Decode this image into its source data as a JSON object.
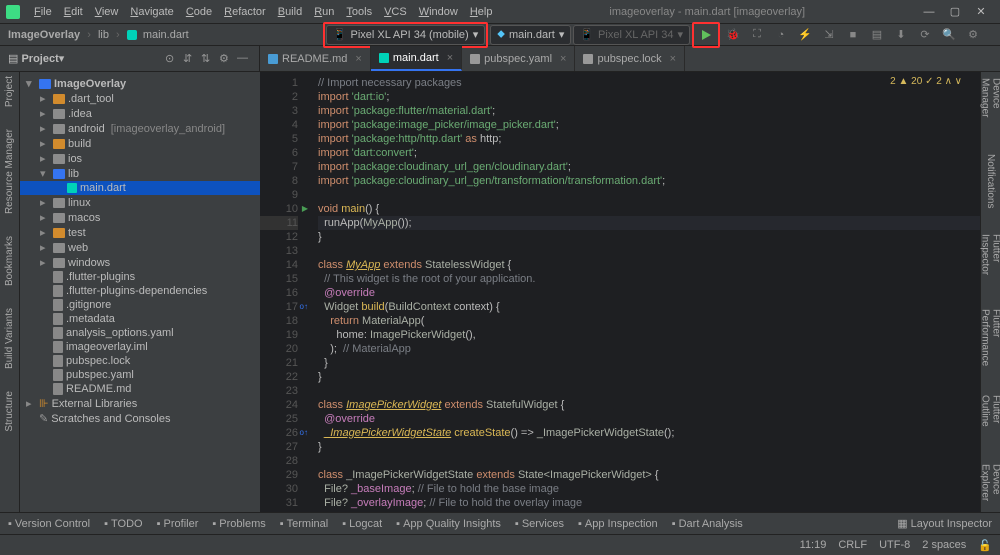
{
  "window": {
    "title": "imageoverlay - main.dart [imageoverlay]",
    "menus": [
      "File",
      "Edit",
      "View",
      "Navigate",
      "Code",
      "Refactor",
      "Build",
      "Run",
      "Tools",
      "VCS",
      "Window",
      "Help"
    ]
  },
  "breadcrumb": {
    "project": "ImageOverlay",
    "folder": "lib",
    "file": "main.dart"
  },
  "project_panel": {
    "title": "Project"
  },
  "device_selector": {
    "label": "Pixel XL API 34 (mobile)"
  },
  "run_config": {
    "label": "main.dart"
  },
  "run_target": {
    "label": "Pixel XL API 34"
  },
  "editor_tabs": [
    {
      "label": "README.md",
      "icon": "md"
    },
    {
      "label": "main.dart",
      "icon": "dart",
      "active": true
    },
    {
      "label": "pubspec.yaml",
      "icon": "yaml"
    },
    {
      "label": "pubspec.lock",
      "icon": "lock"
    }
  ],
  "warnings": {
    "text": "2 ▲ 20 ✓ 2 ∧ ∨"
  },
  "tree": [
    {
      "ind": 0,
      "arrow": "▾",
      "icon": "folder-blue",
      "label": "ImageOverlay",
      "bold": true
    },
    {
      "ind": 1,
      "arrow": "▸",
      "icon": "folder-orange",
      "label": ".dart_tool"
    },
    {
      "ind": 1,
      "arrow": "▸",
      "icon": "folder",
      "label": ".idea"
    },
    {
      "ind": 1,
      "arrow": "▸",
      "icon": "folder",
      "label": "android",
      "suffix": "[imageoverlay_android]"
    },
    {
      "ind": 1,
      "arrow": "▸",
      "icon": "folder-orange",
      "label": "build"
    },
    {
      "ind": 1,
      "arrow": "▸",
      "icon": "folder",
      "label": "ios"
    },
    {
      "ind": 1,
      "arrow": "▾",
      "icon": "folder-blue",
      "label": "lib"
    },
    {
      "ind": 2,
      "arrow": "",
      "icon": "dart",
      "label": "main.dart",
      "selected": true
    },
    {
      "ind": 1,
      "arrow": "▸",
      "icon": "folder",
      "label": "linux"
    },
    {
      "ind": 1,
      "arrow": "▸",
      "icon": "folder",
      "label": "macos"
    },
    {
      "ind": 1,
      "arrow": "▸",
      "icon": "folder-orange",
      "label": "test"
    },
    {
      "ind": 1,
      "arrow": "▸",
      "icon": "folder",
      "label": "web"
    },
    {
      "ind": 1,
      "arrow": "▸",
      "icon": "folder",
      "label": "windows"
    },
    {
      "ind": 1,
      "arrow": "",
      "icon": "file",
      "label": ".flutter-plugins"
    },
    {
      "ind": 1,
      "arrow": "",
      "icon": "file",
      "label": ".flutter-plugins-dependencies"
    },
    {
      "ind": 1,
      "arrow": "",
      "icon": "file",
      "label": ".gitignore"
    },
    {
      "ind": 1,
      "arrow": "",
      "icon": "file",
      "label": ".metadata"
    },
    {
      "ind": 1,
      "arrow": "",
      "icon": "file",
      "label": "analysis_options.yaml"
    },
    {
      "ind": 1,
      "arrow": "",
      "icon": "file",
      "label": "imageoverlay.iml"
    },
    {
      "ind": 1,
      "arrow": "",
      "icon": "file",
      "label": "pubspec.lock"
    },
    {
      "ind": 1,
      "arrow": "",
      "icon": "file",
      "label": "pubspec.yaml"
    },
    {
      "ind": 1,
      "arrow": "",
      "icon": "file",
      "label": "README.md"
    },
    {
      "ind": 0,
      "arrow": "▸",
      "icon": "lib",
      "label": "External Libraries"
    },
    {
      "ind": 0,
      "arrow": "",
      "icon": "scratch",
      "label": "Scratches and Consoles"
    }
  ],
  "code_lines": [
    {
      "n": 1,
      "tokens": [
        {
          "c": "cmt",
          "t": "// Import necessary packages"
        }
      ]
    },
    {
      "n": 2,
      "tokens": [
        {
          "c": "kw",
          "t": "import "
        },
        {
          "c": "str",
          "t": "'dart:io'"
        },
        {
          "c": "",
          "t": ";"
        }
      ]
    },
    {
      "n": 3,
      "tokens": [
        {
          "c": "kw",
          "t": "import "
        },
        {
          "c": "str",
          "t": "'package:flutter/material.dart'"
        },
        {
          "c": "",
          "t": ";"
        }
      ]
    },
    {
      "n": 4,
      "tokens": [
        {
          "c": "kw",
          "t": "import "
        },
        {
          "c": "str",
          "t": "'package:image_picker/image_picker.dart'"
        },
        {
          "c": "",
          "t": ";"
        }
      ]
    },
    {
      "n": 5,
      "tokens": [
        {
          "c": "kw",
          "t": "import "
        },
        {
          "c": "str",
          "t": "'package:http/http.dart'"
        },
        {
          "c": "kw",
          "t": " as "
        },
        {
          "c": "",
          "t": "http;"
        }
      ]
    },
    {
      "n": 6,
      "tokens": [
        {
          "c": "kw",
          "t": "import "
        },
        {
          "c": "str",
          "t": "'dart:convert'"
        },
        {
          "c": "",
          "t": ";"
        }
      ]
    },
    {
      "n": 7,
      "tokens": [
        {
          "c": "kw",
          "t": "import "
        },
        {
          "c": "str",
          "t": "'package:cloudinary_url_gen/cloudinary.dart'"
        },
        {
          "c": "",
          "t": ";"
        }
      ]
    },
    {
      "n": 8,
      "tokens": [
        {
          "c": "kw",
          "t": "import "
        },
        {
          "c": "str",
          "t": "'package:cloudinary_url_gen/transformation/transformation.dart'"
        },
        {
          "c": "",
          "t": ";"
        }
      ]
    },
    {
      "n": 9,
      "tokens": []
    },
    {
      "n": 10,
      "run": true,
      "tokens": [
        {
          "c": "kw",
          "t": "void "
        },
        {
          "c": "fn",
          "t": "main"
        },
        {
          "c": "",
          "t": "() {"
        }
      ]
    },
    {
      "n": 11,
      "hl": true,
      "tokens": [
        {
          "c": "",
          "t": "  runApp("
        },
        {
          "c": "type",
          "t": "MyApp"
        },
        {
          "c": "",
          "t": "());"
        }
      ]
    },
    {
      "n": 12,
      "tokens": [
        {
          "c": "",
          "t": "}"
        }
      ]
    },
    {
      "n": 13,
      "tokens": []
    },
    {
      "n": 14,
      "tokens": [
        {
          "c": "kw",
          "t": "class "
        },
        {
          "c": "cls",
          "t": "MyApp"
        },
        {
          "c": "kw",
          "t": " extends "
        },
        {
          "c": "type",
          "t": "StatelessWidget"
        },
        {
          "c": "",
          "t": " {"
        }
      ]
    },
    {
      "n": 15,
      "tokens": [
        {
          "c": "cmt",
          "t": "  // This widget is the root of your application."
        }
      ]
    },
    {
      "n": 16,
      "tokens": [
        {
          "c": "var",
          "t": "  @override"
        }
      ]
    },
    {
      "n": 17,
      "ov": true,
      "tokens": [
        {
          "c": "",
          "t": "  "
        },
        {
          "c": "type",
          "t": "Widget "
        },
        {
          "c": "fn",
          "t": "build"
        },
        {
          "c": "",
          "t": "("
        },
        {
          "c": "type",
          "t": "BuildContext"
        },
        {
          "c": "",
          "t": " context) {"
        }
      ]
    },
    {
      "n": 18,
      "tokens": [
        {
          "c": "kw",
          "t": "    return "
        },
        {
          "c": "type",
          "t": "MaterialApp"
        },
        {
          "c": "",
          "t": "("
        }
      ]
    },
    {
      "n": 19,
      "tokens": [
        {
          "c": "",
          "t": "      home: "
        },
        {
          "c": "type",
          "t": "ImagePickerWidget"
        },
        {
          "c": "",
          "t": "(),"
        }
      ]
    },
    {
      "n": 20,
      "tokens": [
        {
          "c": "",
          "t": "    ); "
        },
        {
          "c": "cmt",
          "t": " // MaterialApp"
        }
      ]
    },
    {
      "n": 21,
      "tokens": [
        {
          "c": "",
          "t": "  }"
        }
      ]
    },
    {
      "n": 22,
      "tokens": [
        {
          "c": "",
          "t": "}"
        }
      ]
    },
    {
      "n": 23,
      "tokens": []
    },
    {
      "n": 24,
      "tokens": [
        {
          "c": "kw",
          "t": "class "
        },
        {
          "c": "cls",
          "t": "ImagePickerWidget"
        },
        {
          "c": "kw",
          "t": " extends "
        },
        {
          "c": "type",
          "t": "StatefulWidget"
        },
        {
          "c": "",
          "t": " {"
        }
      ]
    },
    {
      "n": 25,
      "tokens": [
        {
          "c": "var",
          "t": "  @override"
        }
      ]
    },
    {
      "n": 26,
      "ov": true,
      "tokens": [
        {
          "c": "",
          "t": "  "
        },
        {
          "c": "cls",
          "t": "_ImagePickerWidgetState"
        },
        {
          "c": "",
          "t": " "
        },
        {
          "c": "fn",
          "t": "createState"
        },
        {
          "c": "",
          "t": "() => "
        },
        {
          "c": "type",
          "t": "_ImagePickerWidgetState"
        },
        {
          "c": "",
          "t": "();"
        }
      ]
    },
    {
      "n": 27,
      "tokens": [
        {
          "c": "",
          "t": "}"
        }
      ]
    },
    {
      "n": 28,
      "tokens": []
    },
    {
      "n": 29,
      "tokens": [
        {
          "c": "kw",
          "t": "class "
        },
        {
          "c": "type",
          "t": "_ImagePickerWidgetState "
        },
        {
          "c": "kw",
          "t": "extends "
        },
        {
          "c": "type",
          "t": "State<ImagePickerWidget>"
        },
        {
          "c": "",
          "t": " {"
        }
      ]
    },
    {
      "n": 30,
      "tokens": [
        {
          "c": "",
          "t": "  "
        },
        {
          "c": "type",
          "t": "File?"
        },
        {
          "c": "",
          "t": " "
        },
        {
          "c": "var",
          "t": "_baseImage"
        },
        {
          "c": "",
          "t": "; "
        },
        {
          "c": "cmt",
          "t": "// File to hold the base image"
        }
      ]
    },
    {
      "n": 31,
      "tokens": [
        {
          "c": "",
          "t": "  "
        },
        {
          "c": "type",
          "t": "File?"
        },
        {
          "c": "",
          "t": " "
        },
        {
          "c": "var",
          "t": "_overlayImage"
        },
        {
          "c": "",
          "t": "; "
        },
        {
          "c": "cmt",
          "t": "// File to hold the overlay image"
        }
      ]
    }
  ],
  "left_rail": [
    "Project",
    "Resource Manager",
    "Bookmarks",
    "Build Variants",
    "Structure"
  ],
  "right_rail": [
    "Device Manager",
    "Notifications",
    "Flutter Inspector",
    "Flutter Performance",
    "Flutter Outline",
    "Device Explorer"
  ],
  "bottom_tools": [
    "Version Control",
    "TODO",
    "Profiler",
    "Problems",
    "Terminal",
    "Logcat",
    "App Quality Insights",
    "Services",
    "App Inspection",
    "Dart Analysis"
  ],
  "bottom_right": "Layout Inspector",
  "status": {
    "pos": "11:19",
    "le": "CRLF",
    "enc": "UTF-8",
    "indent": "2 spaces"
  }
}
